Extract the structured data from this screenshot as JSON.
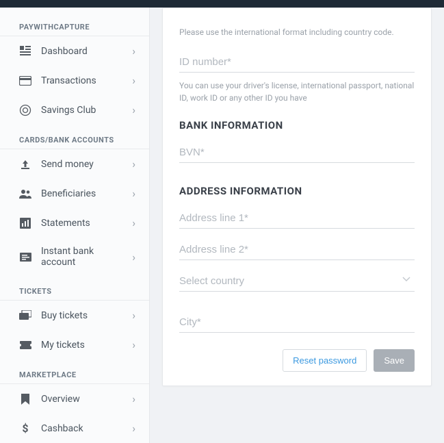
{
  "sidebar": {
    "sections": [
      {
        "heading": "PAYWITHCAPTURE",
        "items": [
          {
            "label": "Dashboard",
            "icon": "dashboard"
          },
          {
            "label": "Transactions",
            "icon": "card"
          },
          {
            "label": "Savings Club",
            "icon": "savings"
          }
        ]
      },
      {
        "heading": "CARDS/BANK ACCOUNTS",
        "items": [
          {
            "label": "Send money",
            "icon": "upload"
          },
          {
            "label": "Beneficiaries",
            "icon": "people"
          },
          {
            "label": "Statements",
            "icon": "chart"
          },
          {
            "label": "Instant bank account",
            "icon": "cheque"
          }
        ]
      },
      {
        "heading": "TICKETS",
        "items": [
          {
            "label": "Buy tickets",
            "icon": "tickets"
          },
          {
            "label": "My tickets",
            "icon": "ticket"
          }
        ]
      },
      {
        "heading": "MARKETPLACE",
        "items": [
          {
            "label": "Overview",
            "icon": "bookmark"
          },
          {
            "label": "Cashback",
            "icon": "dollar"
          }
        ]
      }
    ]
  },
  "form": {
    "phone_help": "Please use the international format including country code.",
    "id_number_ph": "ID number*",
    "id_help": "You can use your driver's license, international passport, national ID, work ID or any other ID you have",
    "bank_section": "BANK INFORMATION",
    "bvn_ph": "BVN*",
    "address_section": "ADDRESS INFORMATION",
    "addr1_ph": "Address line 1*",
    "addr2_ph": "Address line 2*",
    "country_ph": "Select country",
    "city_ph": "City*",
    "reset_label": "Reset password",
    "save_label": "Save"
  }
}
